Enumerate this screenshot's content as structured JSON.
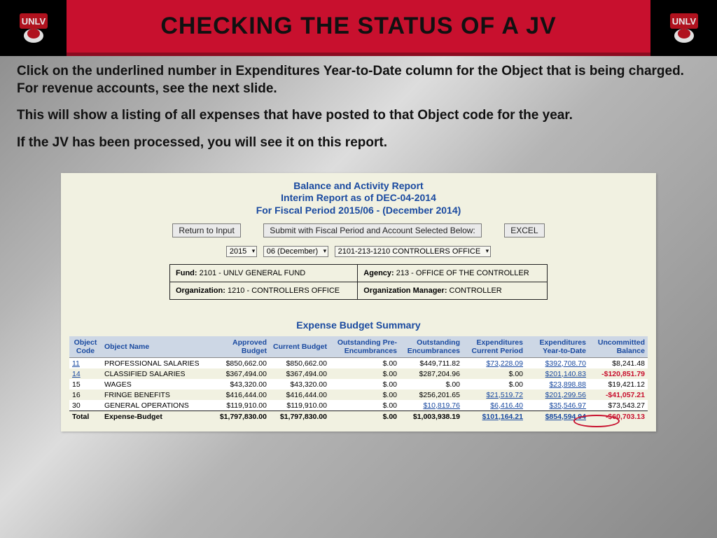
{
  "header": {
    "title": "CHECKING THE STATUS OF A JV",
    "logo_alt": "UNLV"
  },
  "intro": {
    "p1": "Click on the underlined number in Expenditures Year-to-Date column for the Object that is being charged.  For revenue accounts, see the next slide.",
    "p2": "This will show a listing of all expenses that have posted to that Object code for the year.",
    "p3": "If the JV has been processed, you will see it on this report."
  },
  "report": {
    "title_line1": "Balance and Activity Report",
    "title_line2": "Interim Report as of DEC-04-2014",
    "title_line3": "For Fiscal Period 2015/06 - (December  2014)",
    "buttons": {
      "return": "Return to Input",
      "submit": "Submit with Fiscal Period and Account Selected Below:",
      "excel": "EXCEL"
    },
    "selects": {
      "year": "2015",
      "period": "06  (December)",
      "account": "2101-213-1210  CONTROLLERS OFFICE"
    },
    "info": {
      "fund_label": "Fund:",
      "fund_value": "2101 - UNLV GENERAL FUND",
      "agency_label": "Agency:",
      "agency_value": "213 - OFFICE OF THE CONTROLLER",
      "org_label": "Organization:",
      "org_value": "1210 - CONTROLLERS OFFICE",
      "mgr_label": "Organization Manager:",
      "mgr_value": "CONTROLLER"
    },
    "section_title": "Expense Budget Summary",
    "columns": {
      "c0": "Object Code",
      "c1": "Object Name",
      "c2": "Approved Budget",
      "c3": "Current Budget",
      "c4": "Outstanding Pre-Encumbrances",
      "c5": "Outstanding Encumbrances",
      "c6": "Expenditures Current Period",
      "c7": "Expenditures Year-to-Date",
      "c8": "Uncommitted Balance"
    },
    "rows": [
      {
        "code": "11",
        "code_link": true,
        "name": "PROFESSIONAL SALARIES",
        "approved": "$850,662.00",
        "current": "$850,662.00",
        "preenc": "$.00",
        "enc": "$449,711.82",
        "exp_cp": "$73,228.09",
        "exp_cp_link": true,
        "exp_ytd": "$392,708.70",
        "exp_ytd_link": true,
        "uncom": "$8,241.48",
        "uncom_cls": ""
      },
      {
        "code": "14",
        "code_link": true,
        "name": "CLASSIFIED SALARIES",
        "approved": "$367,494.00",
        "current": "$367,494.00",
        "preenc": "$.00",
        "enc": "$287,204.96",
        "exp_cp": "$.00",
        "exp_cp_link": false,
        "exp_ytd": "$201,140.83",
        "exp_ytd_link": true,
        "uncom": "-$120,851.79",
        "uncom_cls": "neg"
      },
      {
        "code": "15",
        "code_link": false,
        "name": "WAGES",
        "approved": "$43,320.00",
        "current": "$43,320.00",
        "preenc": "$.00",
        "enc": "$.00",
        "exp_cp": "$.00",
        "exp_cp_link": false,
        "exp_ytd": "$23,898.88",
        "exp_ytd_link": true,
        "uncom": "$19,421.12",
        "uncom_cls": ""
      },
      {
        "code": "16",
        "code_link": false,
        "name": "FRINGE BENEFITS",
        "approved": "$416,444.00",
        "current": "$416,444.00",
        "preenc": "$.00",
        "enc": "$256,201.65",
        "exp_cp": "$21,519.72",
        "exp_cp_link": true,
        "exp_ytd": "$201,299.56",
        "exp_ytd_link": true,
        "uncom": "-$41,057.21",
        "uncom_cls": "neg"
      },
      {
        "code": "30",
        "code_link": false,
        "name": "GENERAL OPERATIONS",
        "approved": "$119,910.00",
        "current": "$119,910.00",
        "preenc": "$.00",
        "enc": "$10,819.76",
        "enc_link": true,
        "exp_cp": "$6,416.40",
        "exp_cp_link": true,
        "exp_ytd": "$35,546.97",
        "exp_ytd_link": true,
        "uncom": "$73,543.27",
        "uncom_cls": ""
      }
    ],
    "total": {
      "label": "Total",
      "name": "Expense-Budget",
      "approved": "$1,797,830.00",
      "current": "$1,797,830.00",
      "preenc": "$.00",
      "enc": "$1,003,938.19",
      "exp_cp": "$101,164.21",
      "exp_ytd": "$854,594.94",
      "uncom": "-$60,703.13"
    }
  }
}
